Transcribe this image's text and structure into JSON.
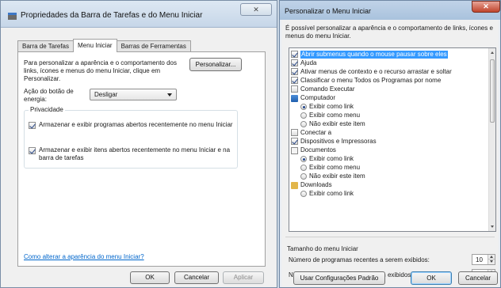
{
  "left_dialog": {
    "title": "Propriedades da Barra de Tarefas e do Menu Iniciar",
    "close_glyph": "✕",
    "tabs": [
      {
        "label": "Barra de Tarefas",
        "active": false
      },
      {
        "label": "Menu Iniciar",
        "active": true
      },
      {
        "label": "Barras de Ferramentas",
        "active": false
      }
    ],
    "intro_text": "Para personalizar a aparência e o comportamento dos links, ícones e menus do menu Iniciar, clique em Personalizar.",
    "personalize_button": "Personalizar...",
    "power_label": "Ação do botão de energia:",
    "power_value": "Desligar",
    "privacy_legend": "Privacidade",
    "privacy_options": [
      {
        "label": "Armazenar e exibir programas abertos recentemente no menu Iniciar",
        "checked": true
      },
      {
        "label": "Armazenar e exibir itens abertos recentemente no menu Iniciar e na barra de tarefas",
        "checked": true
      }
    ],
    "help_link": "Como alterar a aparência do menu Iniciar?",
    "ok_button": "OK",
    "cancel_button": "Cancelar",
    "apply_button": "Aplicar"
  },
  "right_dialog": {
    "title": "Personalizar o Menu Iniciar",
    "close_glyph": "✕",
    "intro_text": "É possível personalizar a aparência e o comportamento de links, ícones e menus do menu Iniciar.",
    "items": [
      {
        "kind": "check",
        "label": "Abrir submenus quando o mouse pausar sobre eles",
        "checked": true,
        "selected": true
      },
      {
        "kind": "check",
        "label": "Ajuda",
        "checked": true
      },
      {
        "kind": "check",
        "label": "Ativar menus de contexto e o recurso arrastar e soltar",
        "checked": true
      },
      {
        "kind": "check",
        "label": "Classificar o menu Todos os Programas por nome",
        "checked": true
      },
      {
        "kind": "check",
        "label": "Comando Executar",
        "checked": false
      },
      {
        "kind": "group",
        "label": "Computador",
        "icon": "computer-icon"
      },
      {
        "kind": "radio",
        "label": "Exibir como link",
        "checked": true
      },
      {
        "kind": "radio",
        "label": "Exibir como menu",
        "checked": false
      },
      {
        "kind": "radio",
        "label": "Não exibir este item",
        "checked": false
      },
      {
        "kind": "check",
        "label": "Conectar a",
        "checked": false
      },
      {
        "kind": "check",
        "label": "Dispositivos e Impressoras",
        "checked": true
      },
      {
        "kind": "group",
        "label": "Documentos",
        "icon": "documents-icon"
      },
      {
        "kind": "radio",
        "label": "Exibir como link",
        "checked": true
      },
      {
        "kind": "radio",
        "label": "Exibir como menu",
        "checked": false
      },
      {
        "kind": "radio",
        "label": "Não exibir este item",
        "checked": false
      },
      {
        "kind": "group",
        "label": "Downloads",
        "icon": "downloads-icon"
      },
      {
        "kind": "radio",
        "label": "Exibir como link",
        "checked": false
      }
    ],
    "size_section_title": "Tamanho do menu Iniciar",
    "recent_programs_label": "Número de programas recentes a serem exibidos:",
    "recent_programs_value": "10",
    "recent_items_label": "Número de itens recentes a serem exibidos:",
    "recent_items_value": "10",
    "default_button": "Usar Configurações Padrão",
    "ok_button": "OK",
    "cancel_button": "Cancelar"
  }
}
